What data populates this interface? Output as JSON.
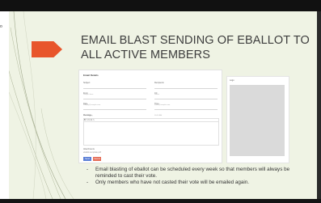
{
  "slide": {
    "title": "EMAIL BLAST SENDING OF EBALLOT TO ALL ACTIVE MEMBERS",
    "bullets": [
      "Email blasting of eballot can be scheduled every week so that members will always be reminded to cast their vote.",
      "Only members who have not casted their vote will be emailed again."
    ],
    "bullet_marker": "-",
    "corner_text": "o",
    "accent_color": "#e8552b",
    "background_color": "#eff3e4"
  },
  "form": {
    "header": "Email Details",
    "fields": [
      {
        "label": "Subject",
        "placeholder": "Subject here"
      },
      {
        "label": "Recipients",
        "placeholder": "Select"
      },
      {
        "label": "From",
        "placeholder": "noreply@sample.com"
      },
      {
        "label": "CC",
        "placeholder": "email@sample.com"
      },
      {
        "label": "Date",
        "placeholder": "mm/dd/yyyy"
      },
      {
        "label": "Time",
        "placeholder": "00:00 AM"
      }
    ],
    "message_label": "Message",
    "toolbar": "B I U ≡ ⧉ ✎",
    "attachment_label": "Attachments",
    "attachment_value": "eballot-template.pdf",
    "send_label": "Send",
    "cancel_label": "Cancel"
  },
  "preview": {
    "header": "Logo"
  }
}
